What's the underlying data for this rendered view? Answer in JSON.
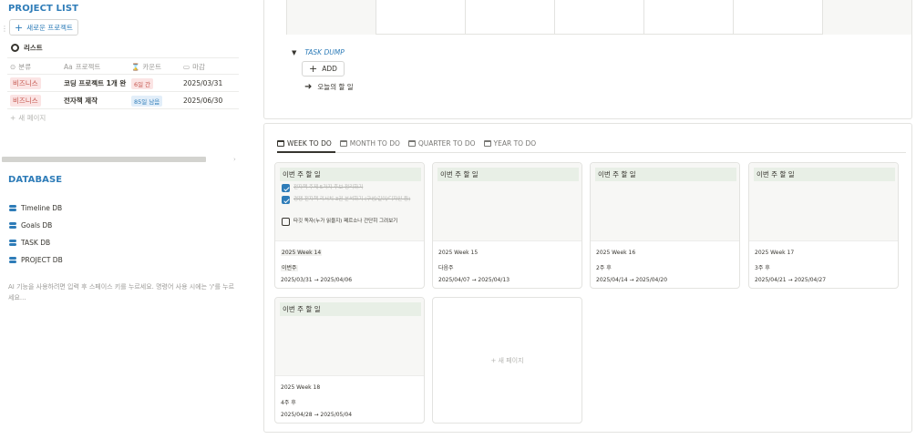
{
  "project_list": {
    "title": "PROJECT LIST",
    "new_button": "새로운 프로젝트",
    "view_label": "리스트",
    "columns": [
      "분류",
      "프로젝트",
      "카운트",
      "마감"
    ],
    "column_icons": [
      "circle-dot-icon",
      "text-aa-icon",
      "hourglass-icon",
      "calendar-icon"
    ],
    "rows": [
      {
        "category": "비즈니스",
        "name": "코딩 프로젝트 1개 완",
        "count": "6일 간",
        "due": "2025/03/31"
      },
      {
        "category": "비즈니스",
        "name": "전자책 제작",
        "count": "85일 남음",
        "due": "2025/06/30"
      }
    ],
    "new_page": "새 페이지"
  },
  "database": {
    "title": "DATABASE",
    "items": [
      "Timeline DB",
      "Goals DB",
      "TASK DB",
      "PROJECT DB"
    ]
  },
  "ai_hint": "AI 기능을 사용하려면 입력 후 스페이스 키를 누르세요. 명령어 사용 시에는 '/'를 누르세요...",
  "task_dump": {
    "label": "TASK DUMP",
    "add_button": "ADD",
    "today_link": "오늘의 할 일"
  },
  "tabs": [
    {
      "label": "WEEK TO DO",
      "active": true
    },
    {
      "label": "MONTH TO DO",
      "active": false
    },
    {
      "label": "QUARTER TO DO",
      "active": false
    },
    {
      "label": "YEAR TO DO",
      "active": false
    }
  ],
  "cards": [
    {
      "title": "이번 주 할 일",
      "todos": [
        {
          "text": "전자책 주제 5가지 후보 정리하기",
          "done": true
        },
        {
          "text": "경쟁 전자책 리서치 3권 분석하기 (구성/길이/디자인 등)",
          "done": true
        },
        {
          "text": "타깃 독자(누가 읽을지) 페르소나 간단히 그려보기",
          "done": false
        }
      ],
      "week": "2025 Week 14",
      "relative": "이번주",
      "range": "2025/03/31 → 2025/04/06"
    },
    {
      "title": "이번 주 할 일",
      "todos": [],
      "week": "2025 Week 15",
      "relative": "다음주",
      "range": "2025/04/07 → 2025/04/13"
    },
    {
      "title": "이번 주 할 일",
      "todos": [],
      "week": "2025 Week 16",
      "relative": "2주 후",
      "range": "2025/04/14 → 2025/04/20"
    },
    {
      "title": "이번 주 할 일",
      "todos": [],
      "week": "2025 Week 17",
      "relative": "3주 후",
      "range": "2025/04/21 → 2025/04/27"
    },
    {
      "title": "이번 주 할 일",
      "todos": [],
      "week": "2025 Week 18",
      "relative": "4주 후",
      "range": "2025/04/28 → 2025/05/04"
    }
  ],
  "new_page_card": "새 페이지",
  "colors": {
    "accent": "#2e7cb8",
    "tag_red_bg": "#fbe4e4",
    "tag_blue_bg": "#e2eef9",
    "card_title_bg": "#e8efe6"
  }
}
